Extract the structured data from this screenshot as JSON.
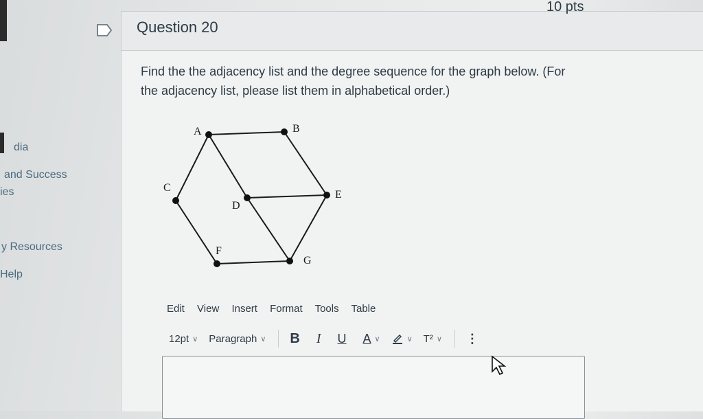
{
  "sidebar": {
    "items": [
      {
        "label": "dia"
      },
      {
        "label": "and Success"
      },
      {
        "label": "ies"
      },
      {
        "label": "y Resources"
      },
      {
        "label": "Help"
      }
    ]
  },
  "question": {
    "title": "Question 20",
    "points": "10 pts",
    "prompt_line1": "Find the the adjacency list and the degree sequence for the graph below. (For",
    "prompt_line2": "the adjacency list, please list them in alphabetical order.)"
  },
  "graph": {
    "nodes": [
      "A",
      "B",
      "C",
      "D",
      "E",
      "F",
      "G"
    ]
  },
  "editor": {
    "menu": [
      "Edit",
      "View",
      "Insert",
      "Format",
      "Tools",
      "Table"
    ],
    "font_size": "12pt",
    "block_format": "Paragraph",
    "bold": "B",
    "italic": "I",
    "underline": "U",
    "text_color": "A",
    "superscript": "T²",
    "more": "⋮"
  },
  "colors": {
    "text": "#2d3b45",
    "link": "#4a6b80"
  }
}
